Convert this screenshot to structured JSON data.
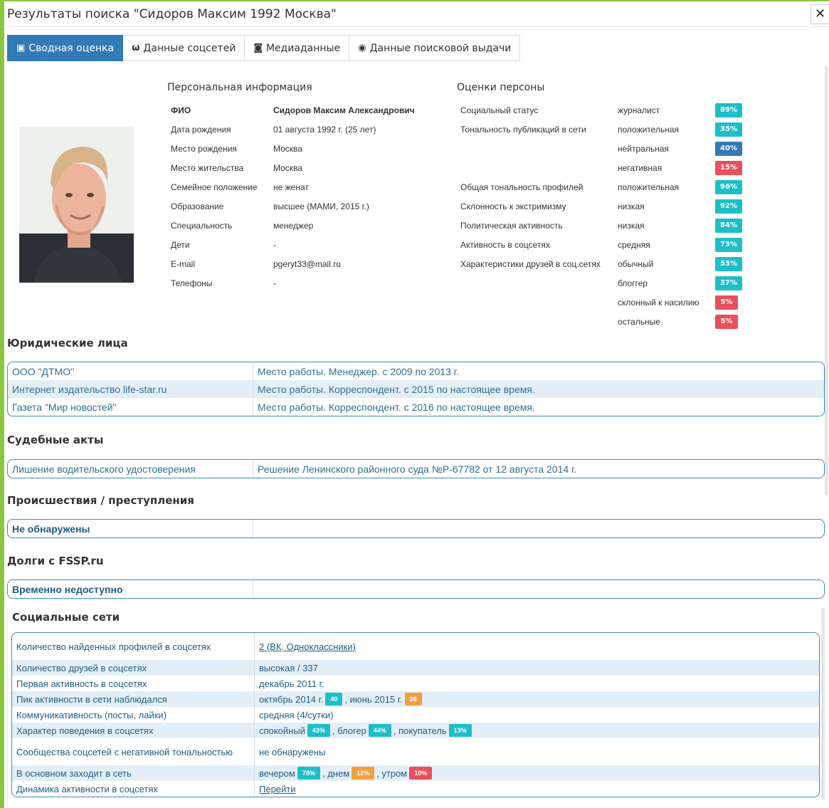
{
  "window": {
    "title": "Результаты поиска \"Сидоров Максим 1992 Москва\"",
    "close": "✕"
  },
  "tabs": [
    {
      "label": "Сводная оценка",
      "icon": "id-card-icon",
      "glyph": "▣",
      "active": true
    },
    {
      "label": "Данные соцсетей",
      "icon": "vk-icon",
      "glyph": "ѡ",
      "active": false
    },
    {
      "label": "Медиаданные",
      "icon": "camera-icon",
      "glyph": "◙",
      "active": false
    },
    {
      "label": "Данные поисковой выдачи",
      "icon": "globe-icon",
      "glyph": "◉",
      "active": false
    }
  ],
  "personal": {
    "heading": "Персональная информация",
    "rows": [
      {
        "label": "ФИО",
        "value": "Сидоров Максим Александрович",
        "bold": true
      },
      {
        "label": "Дата рождения",
        "value": "01 августа 1992 г. (25 лет)"
      },
      {
        "label": "Место рождения",
        "value": "Москва"
      },
      {
        "label": "Место жительства",
        "value": "Москва"
      },
      {
        "label": "Семейное положение",
        "value": "не женат"
      },
      {
        "label": "Образование",
        "value": "высшее (МАМИ, 2015 г.)"
      },
      {
        "label": "Специальность",
        "value": "менеджер"
      },
      {
        "label": "Дети",
        "value": "-"
      },
      {
        "label": "E-mail",
        "value": "pgeryt33@mail.ru"
      },
      {
        "label": "Телефоны",
        "value": "-"
      }
    ]
  },
  "assessment": {
    "heading": "Оценки персоны",
    "rows": [
      {
        "label": "Социальный статус",
        "value": "журналист",
        "badge": "89%",
        "color": "#1ebec9"
      },
      {
        "label": "Тональность публикаций в сети",
        "value": "положительная",
        "badge": "35%",
        "color": "#1ebec9"
      },
      {
        "label": "",
        "value": "нейтральная",
        "badge": "40%",
        "color": "#337ab7"
      },
      {
        "label": "",
        "value": "негативная",
        "badge": "15%",
        "color": "#e8505b"
      },
      {
        "label": "Общая тональность профилей",
        "value": "положительная",
        "badge": "96%",
        "color": "#1ebec9"
      },
      {
        "label": "Склонность к экстримизму",
        "value": "низкая",
        "badge": "92%",
        "color": "#1ebec9"
      },
      {
        "label": "Политическая активность",
        "value": "низкая",
        "badge": "84%",
        "color": "#1ebec9"
      },
      {
        "label": "Активность в соцсетях",
        "value": "средняя",
        "badge": "73%",
        "color": "#1ebec9"
      },
      {
        "label": "Характеристики друзей в соц.сетях",
        "value": "обычный",
        "badge": "53%",
        "color": "#1ebec9"
      },
      {
        "label": "",
        "value": "блоггер",
        "badge": "37%",
        "color": "#1ebec9"
      },
      {
        "label": "",
        "value": "склонный к насилию",
        "badge": "5%",
        "color": "#e8505b",
        "small": true
      },
      {
        "label": "",
        "value": "остальные",
        "badge": "5%",
        "color": "#e8505b",
        "small": true
      }
    ]
  },
  "legal": {
    "heading": "Юридические лица",
    "rows": [
      {
        "name": "ООО \"ДТМО\"",
        "info": "Место работы. Менеджер. с 2009 по 2013 г."
      },
      {
        "name": "Интернет издательство life-star.ru",
        "info": "Место работы. Корреспондент. с 2015 по настоящее время."
      },
      {
        "name": "Газета \"Мир новостей\"",
        "info": "Место работы. Корреспондент. с 2016 по настоящее время."
      }
    ]
  },
  "court": {
    "heading": "Судебные акты",
    "rows": [
      {
        "name": "Лишение водительского удостоверения",
        "info": "Решение Ленинского районного суда №Р-67782 от 12 августа 2014 г."
      }
    ]
  },
  "incidents": {
    "heading": "Происшествия / преступления",
    "value": "Не обнаружены"
  },
  "fssp": {
    "heading": "Долги с FSSP.ru",
    "value": "Временно недоступно"
  },
  "social": {
    "heading": "Социальные сети",
    "rows": [
      {
        "label": "Количество найденных профилей в соцсетях",
        "parts": [
          {
            "t": "link",
            "text": "2 (ВК, Одноклассники)"
          }
        ],
        "tall": true
      },
      {
        "label": "Количество друзей в соцсетях",
        "parts": [
          {
            "t": "text",
            "text": "высокая / 337"
          }
        ]
      },
      {
        "label": "Первая активность в соцсетях",
        "parts": [
          {
            "t": "text",
            "text": "декабрь 2011 г."
          }
        ]
      },
      {
        "label": "Пик активности в сети наблюдался",
        "parts": [
          {
            "t": "text",
            "text": "октябрь 2014 г."
          },
          {
            "t": "badge",
            "text": "40",
            "color": "teal"
          },
          {
            "t": "text",
            "text": ", июнь 2015 г."
          },
          {
            "t": "badge",
            "text": "28",
            "color": "orange"
          }
        ]
      },
      {
        "label": "Коммуникативность (посты, лайки)",
        "parts": [
          {
            "t": "text",
            "text": "средняя (4/сутки)"
          }
        ]
      },
      {
        "label": "Характер поведения в соцсетях",
        "parts": [
          {
            "t": "text",
            "text": "спокойный"
          },
          {
            "t": "badge",
            "text": "43%",
            "color": "teal"
          },
          {
            "t": "text",
            "text": ", блогер"
          },
          {
            "t": "badge",
            "text": "44%",
            "color": "teal"
          },
          {
            "t": "text",
            "text": ", покупатель"
          },
          {
            "t": "badge",
            "text": "13%",
            "color": "teal"
          }
        ]
      },
      {
        "label": "Сообщества соцсетей с негативной тональностью",
        "parts": [
          {
            "t": "text",
            "text": "не обнаружены"
          }
        ],
        "tall": true
      },
      {
        "label": "В основном заходит в сеть",
        "parts": [
          {
            "t": "text",
            "text": "вечером"
          },
          {
            "t": "badge",
            "text": "78%",
            "color": "teal"
          },
          {
            "t": "text",
            "text": ", днем"
          },
          {
            "t": "badge",
            "text": "12%",
            "color": "orange"
          },
          {
            "t": "text",
            "text": ", утром"
          },
          {
            "t": "badge",
            "text": "10%",
            "color": "red"
          }
        ]
      },
      {
        "label": "Динамика активности в соцсетях",
        "parts": [
          {
            "t": "link",
            "text": "Перейти"
          }
        ]
      }
    ]
  }
}
